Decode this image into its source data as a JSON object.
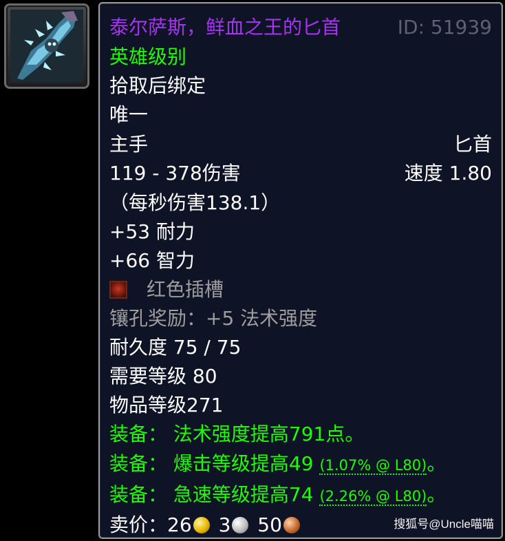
{
  "item": {
    "name": "泰尔萨斯，鲜血之王的匕首",
    "id_text": "ID: 51939",
    "quality": "英雄级别",
    "binding": "拾取后绑定",
    "unique": "唯一",
    "slot": "主手",
    "weapon_type": "匕首",
    "damage": "119 - 378伤害",
    "speed": "速度 1.80",
    "dps": "（每秒伤害138.1）",
    "stat_stamina": "+53 耐力",
    "stat_intellect": "+66 智力",
    "socket_label": "红色插槽",
    "socket_bonus": "镶孔奖励：+5 法术强度",
    "durability": "耐久度 75 / 75",
    "required_level": "需要等级 80",
    "item_level": "物品等级271",
    "equip1": "装备： 法术强度提高791点。",
    "equip2_main": "装备： 爆击等级提高49",
    "equip2_detail": "(1.07% @ L80)",
    "equip2_end": "。",
    "equip3_main": "装备： 急速等级提高74",
    "equip3_detail": "(2.26% @ L80)",
    "equip3_end": "。",
    "sell_label": "卖价：",
    "sell_gold": "26",
    "sell_silver": "3",
    "sell_copper": "50"
  },
  "watermark": "搜狐号@Uncle喵喵",
  "colors": {
    "epic": "#a335ee",
    "uncommon": "#1eff00",
    "poor": "#9d9d9d",
    "tooltip_bg": "#0f1326"
  },
  "icons": {
    "item_icon": "dagger-icon",
    "socket_icon": "red-socket-icon",
    "gold": "gold-coin-icon",
    "silver": "silver-coin-icon",
    "copper": "copper-coin-icon"
  }
}
